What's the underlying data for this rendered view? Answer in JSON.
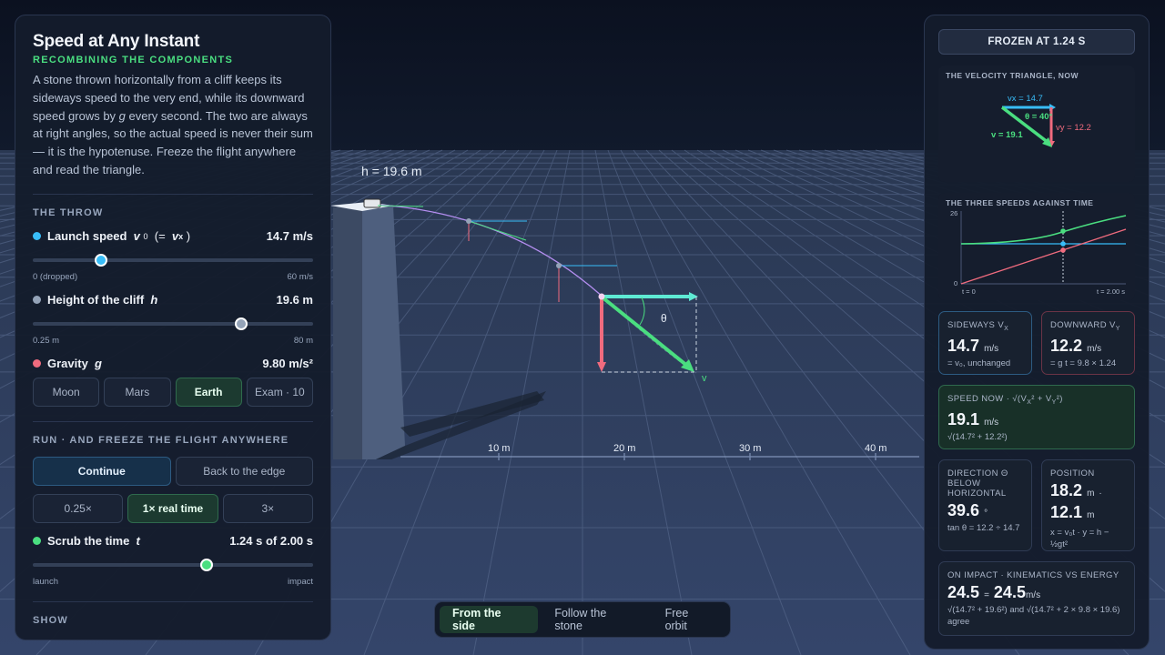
{
  "scene": {
    "height_label": "h = 19.6 m",
    "theta_label": "θ",
    "v_label": "v",
    "axis_ticks": [
      "10 m",
      "20 m",
      "30 m",
      "40 m"
    ]
  },
  "left": {
    "title": "Speed at Any Instant",
    "subtitle": "RECOMBINING THE COMPONENTS",
    "intro_a": "A stone thrown horizontally from a cliff keeps its sideways speed to the very end, while its downward speed grows by ",
    "intro_g": "g",
    "intro_b": " every second. The two are always at right angles, so the actual speed is never their sum — it is the hypotenuse. Freeze the flight anywhere and read the triangle.",
    "throw_section": "THE THROW",
    "launch": {
      "name": "Launch speed",
      "symbol": "v",
      "sub": "0",
      "extra_a": "(=",
      "extra_sym": "v",
      "extra_sub": "x",
      "extra_b": ")",
      "value": "14.7 m/s",
      "min": "0 (dropped)",
      "max": "60 m/s",
      "fraction": 0.245
    },
    "height": {
      "name": "Height of the cliff",
      "symbol": "h",
      "value": "19.6 m",
      "min": "0.25 m",
      "max": "80 m",
      "fraction": 0.745
    },
    "gravity": {
      "name": "Gravity",
      "symbol": "g",
      "value": "9.80 m/s²",
      "options": [
        "Moon",
        "Mars",
        "Earth",
        "Exam · 10"
      ],
      "selected": "Earth"
    },
    "run_section": "RUN · AND FREEZE THE FLIGHT ANYWHERE",
    "continue": "Continue",
    "back": "Back to the edge",
    "speeds": [
      "0.25×",
      "1× real time",
      "3×"
    ],
    "speed_selected": "1× real time",
    "scrub": {
      "name": "Scrub the time",
      "symbol": "t",
      "value": "1.24 s of 2.00 s",
      "min": "launch",
      "max": "impact",
      "fraction": 0.62
    },
    "show_section": "SHOW"
  },
  "right": {
    "frozen": "FROZEN AT 1.24 S",
    "triangle_title": "THE VELOCITY TRIANGLE, NOW",
    "tri_vx": "vx = 14.7",
    "tri_vy": "vy = 12.2",
    "tri_v": "v = 19.1",
    "tri_theta": "θ = 40°",
    "speeds_title": "THE THREE SPEEDS AGAINST TIME",
    "graph_ymax": "26",
    "graph_ymin": "0",
    "graph_t0": "t = 0",
    "graph_t1": "t = 2.00 s",
    "sideways_label": "SIDEWAYS V",
    "sideways_sub": "X",
    "sideways_value": "14.7",
    "sideways_unit": "m/s",
    "sideways_note": "= v₀, unchanged",
    "down_label": "DOWNWARD V",
    "down_sub": "Y",
    "down_value": "12.2",
    "down_unit": "m/s",
    "down_note": "= g t = 9.8 × 1.24",
    "speed_label": "SPEED NOW · √(V",
    "speed_label_b": "² + V",
    "speed_label_c": "²)",
    "speed_value": "19.1",
    "speed_unit": "m/s",
    "speed_note": "√(14.7² + 12.2²)",
    "dir_label": "DIRECTION Θ BELOW HORIZONTAL",
    "dir_value": "39.6",
    "dir_unit": "°",
    "dir_note": "tan θ = 12.2 ÷ 14.7",
    "pos_label": "POSITION",
    "pos_x": "18.2",
    "pos_y": "12.1",
    "pos_unit": "m",
    "pos_sep": "·",
    "pos_note": "x = v₀t · y = h − ½gt²",
    "impact_label": "ON IMPACT · KINEMATICS VS ENERGY",
    "impact_a": "24.5",
    "impact_eq": "=",
    "impact_b": "24.5",
    "impact_unit": "m/s",
    "impact_note": "√(14.7² + 19.6²) and √(14.7² + 2 × 9.8 × 19.6) agree"
  },
  "camera": {
    "options": [
      "From the side",
      "Follow the stone",
      "Free orbit"
    ],
    "selected": "From the side"
  },
  "colors": {
    "vx": "#5eead4",
    "vy": "#f06b7e",
    "v": "#4ade80",
    "accent_blue": "#38bdf8",
    "cliff_dot": "#94a3b8"
  }
}
